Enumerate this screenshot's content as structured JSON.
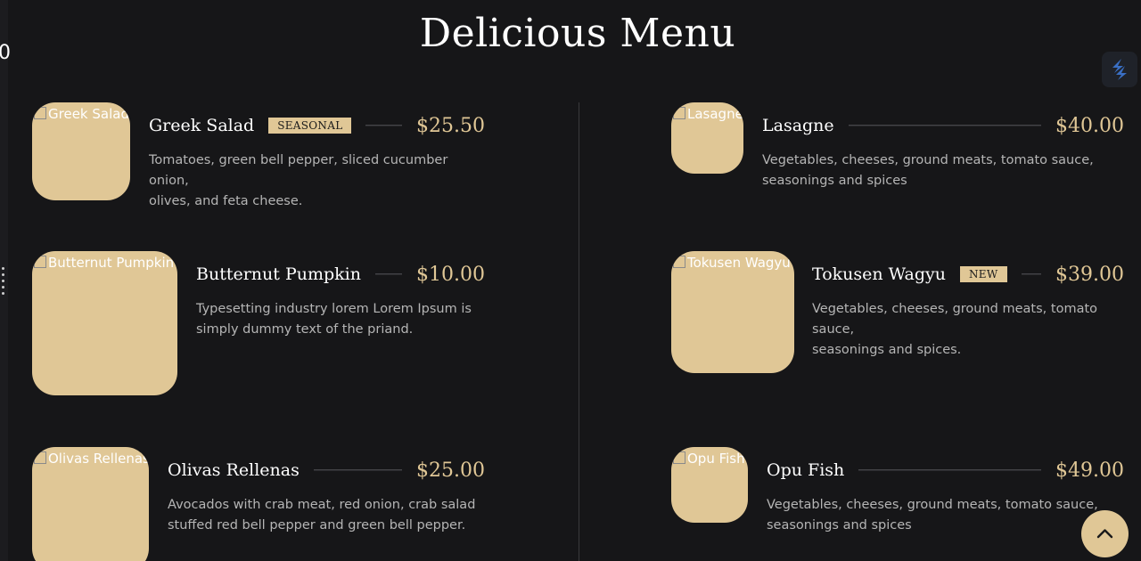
{
  "page": {
    "title": "Delicious Menu",
    "edge_glyph": "0"
  },
  "colors": {
    "background": "#161618",
    "accent": "#e0c796",
    "text": "#ffffff",
    "muted": "#b5b5b5"
  },
  "menu": {
    "items": [
      {
        "name": "Greek Salad",
        "image_alt": "Greek Salad",
        "badge": "SEASONAL",
        "price": "$25.50",
        "desc_line1": "Tomatoes, green bell pepper, sliced cucumber onion,",
        "desc_line2": "olives, and feta cheese."
      },
      {
        "name": "Lasagne",
        "image_alt": "Lasagne",
        "badge": "",
        "price": "$40.00",
        "desc_line1": "Vegetables, cheeses, ground meats, tomato sauce,",
        "desc_line2": "seasonings and spices"
      },
      {
        "name": "Butternut Pumpkin",
        "image_alt": "Butternut Pumpkin",
        "badge": "",
        "price": "$10.00",
        "desc_line1": "Typesetting industry lorem Lorem Ipsum is",
        "desc_line2": "simply dummy text of the priand."
      },
      {
        "name": "Tokusen Wagyu",
        "image_alt": "Tokusen Wagyu",
        "badge": "NEW",
        "price": "$39.00",
        "desc_line1": "Vegetables, cheeses, ground meats, tomato sauce,",
        "desc_line2": "seasonings and spices."
      },
      {
        "name": "Olivas Rellenas",
        "image_alt": "Olivas Rellenas",
        "badge": "",
        "price": "$25.00",
        "desc_line1": "Avocados with crab meat, red onion, crab salad",
        "desc_line2": "stuffed red bell pepper and green bell pepper."
      },
      {
        "name": "Opu Fish",
        "image_alt": "Opu Fish",
        "badge": "",
        "price": "$49.00",
        "desc_line1": "Vegetables, cheeses, ground meats, tomato sauce,",
        "desc_line2": "seasonings and spices"
      }
    ]
  },
  "icons": {
    "extension": "extension-logo-icon",
    "scroll_top": "chevron-up-icon",
    "drag": "drag-handle-icon"
  }
}
